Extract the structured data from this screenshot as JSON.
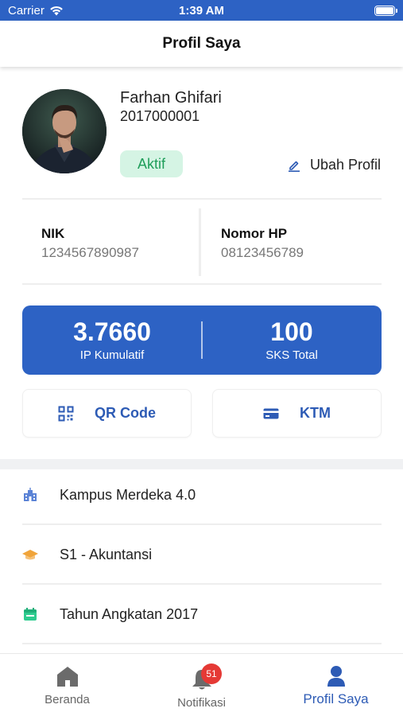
{
  "status_bar": {
    "carrier": "Carrier",
    "time": "1:39 AM"
  },
  "header": {
    "title": "Profil Saya"
  },
  "profile": {
    "name": "Farhan Ghifari",
    "student_id": "2017000001",
    "status": "Aktif",
    "edit_label": "Ubah Profil"
  },
  "info": {
    "nik_label": "NIK",
    "nik_value": "1234567890987",
    "phone_label": "Nomor HP",
    "phone_value": "08123456789"
  },
  "stats": {
    "gpa_value": "3.7660",
    "gpa_label": "IP Kumulatif",
    "sks_value": "100",
    "sks_label": "SKS Total"
  },
  "actions": {
    "qr_label": "QR Code",
    "ktm_label": "KTM"
  },
  "details": [
    {
      "icon": "campus-building-icon",
      "label": "Kampus Merdeka 4.0"
    },
    {
      "icon": "graduation-cap-icon",
      "label": "S1 - Akuntansi"
    },
    {
      "icon": "calendar-icon",
      "label": "Tahun Angkatan 2017"
    }
  ],
  "tabbar": {
    "home_label": "Beranda",
    "notif_label": "Notifikasi",
    "notif_count": "51",
    "profile_label": "Profil Saya"
  },
  "colors": {
    "primary": "#2d62c4",
    "active_badge_bg": "#d5f4e4",
    "active_badge_text": "#1f9e5a",
    "notification_badge": "#e53935"
  }
}
